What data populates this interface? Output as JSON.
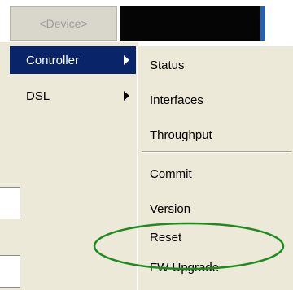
{
  "toolbar": {
    "device_label": "<Device>"
  },
  "menu": {
    "items": [
      {
        "label": "Controller",
        "active": true
      },
      {
        "label": "DSL",
        "active": false
      }
    ]
  },
  "submenu": {
    "group1": [
      "Status",
      "Interfaces",
      "Throughput"
    ],
    "group2": [
      "Commit",
      "Version",
      "Reset",
      "FW Upgrade"
    ]
  },
  "colors": {
    "menu_highlight": "#0a246a",
    "menu_background": "#ece9d8",
    "annotation_ellipse": "#1f8a1f"
  }
}
